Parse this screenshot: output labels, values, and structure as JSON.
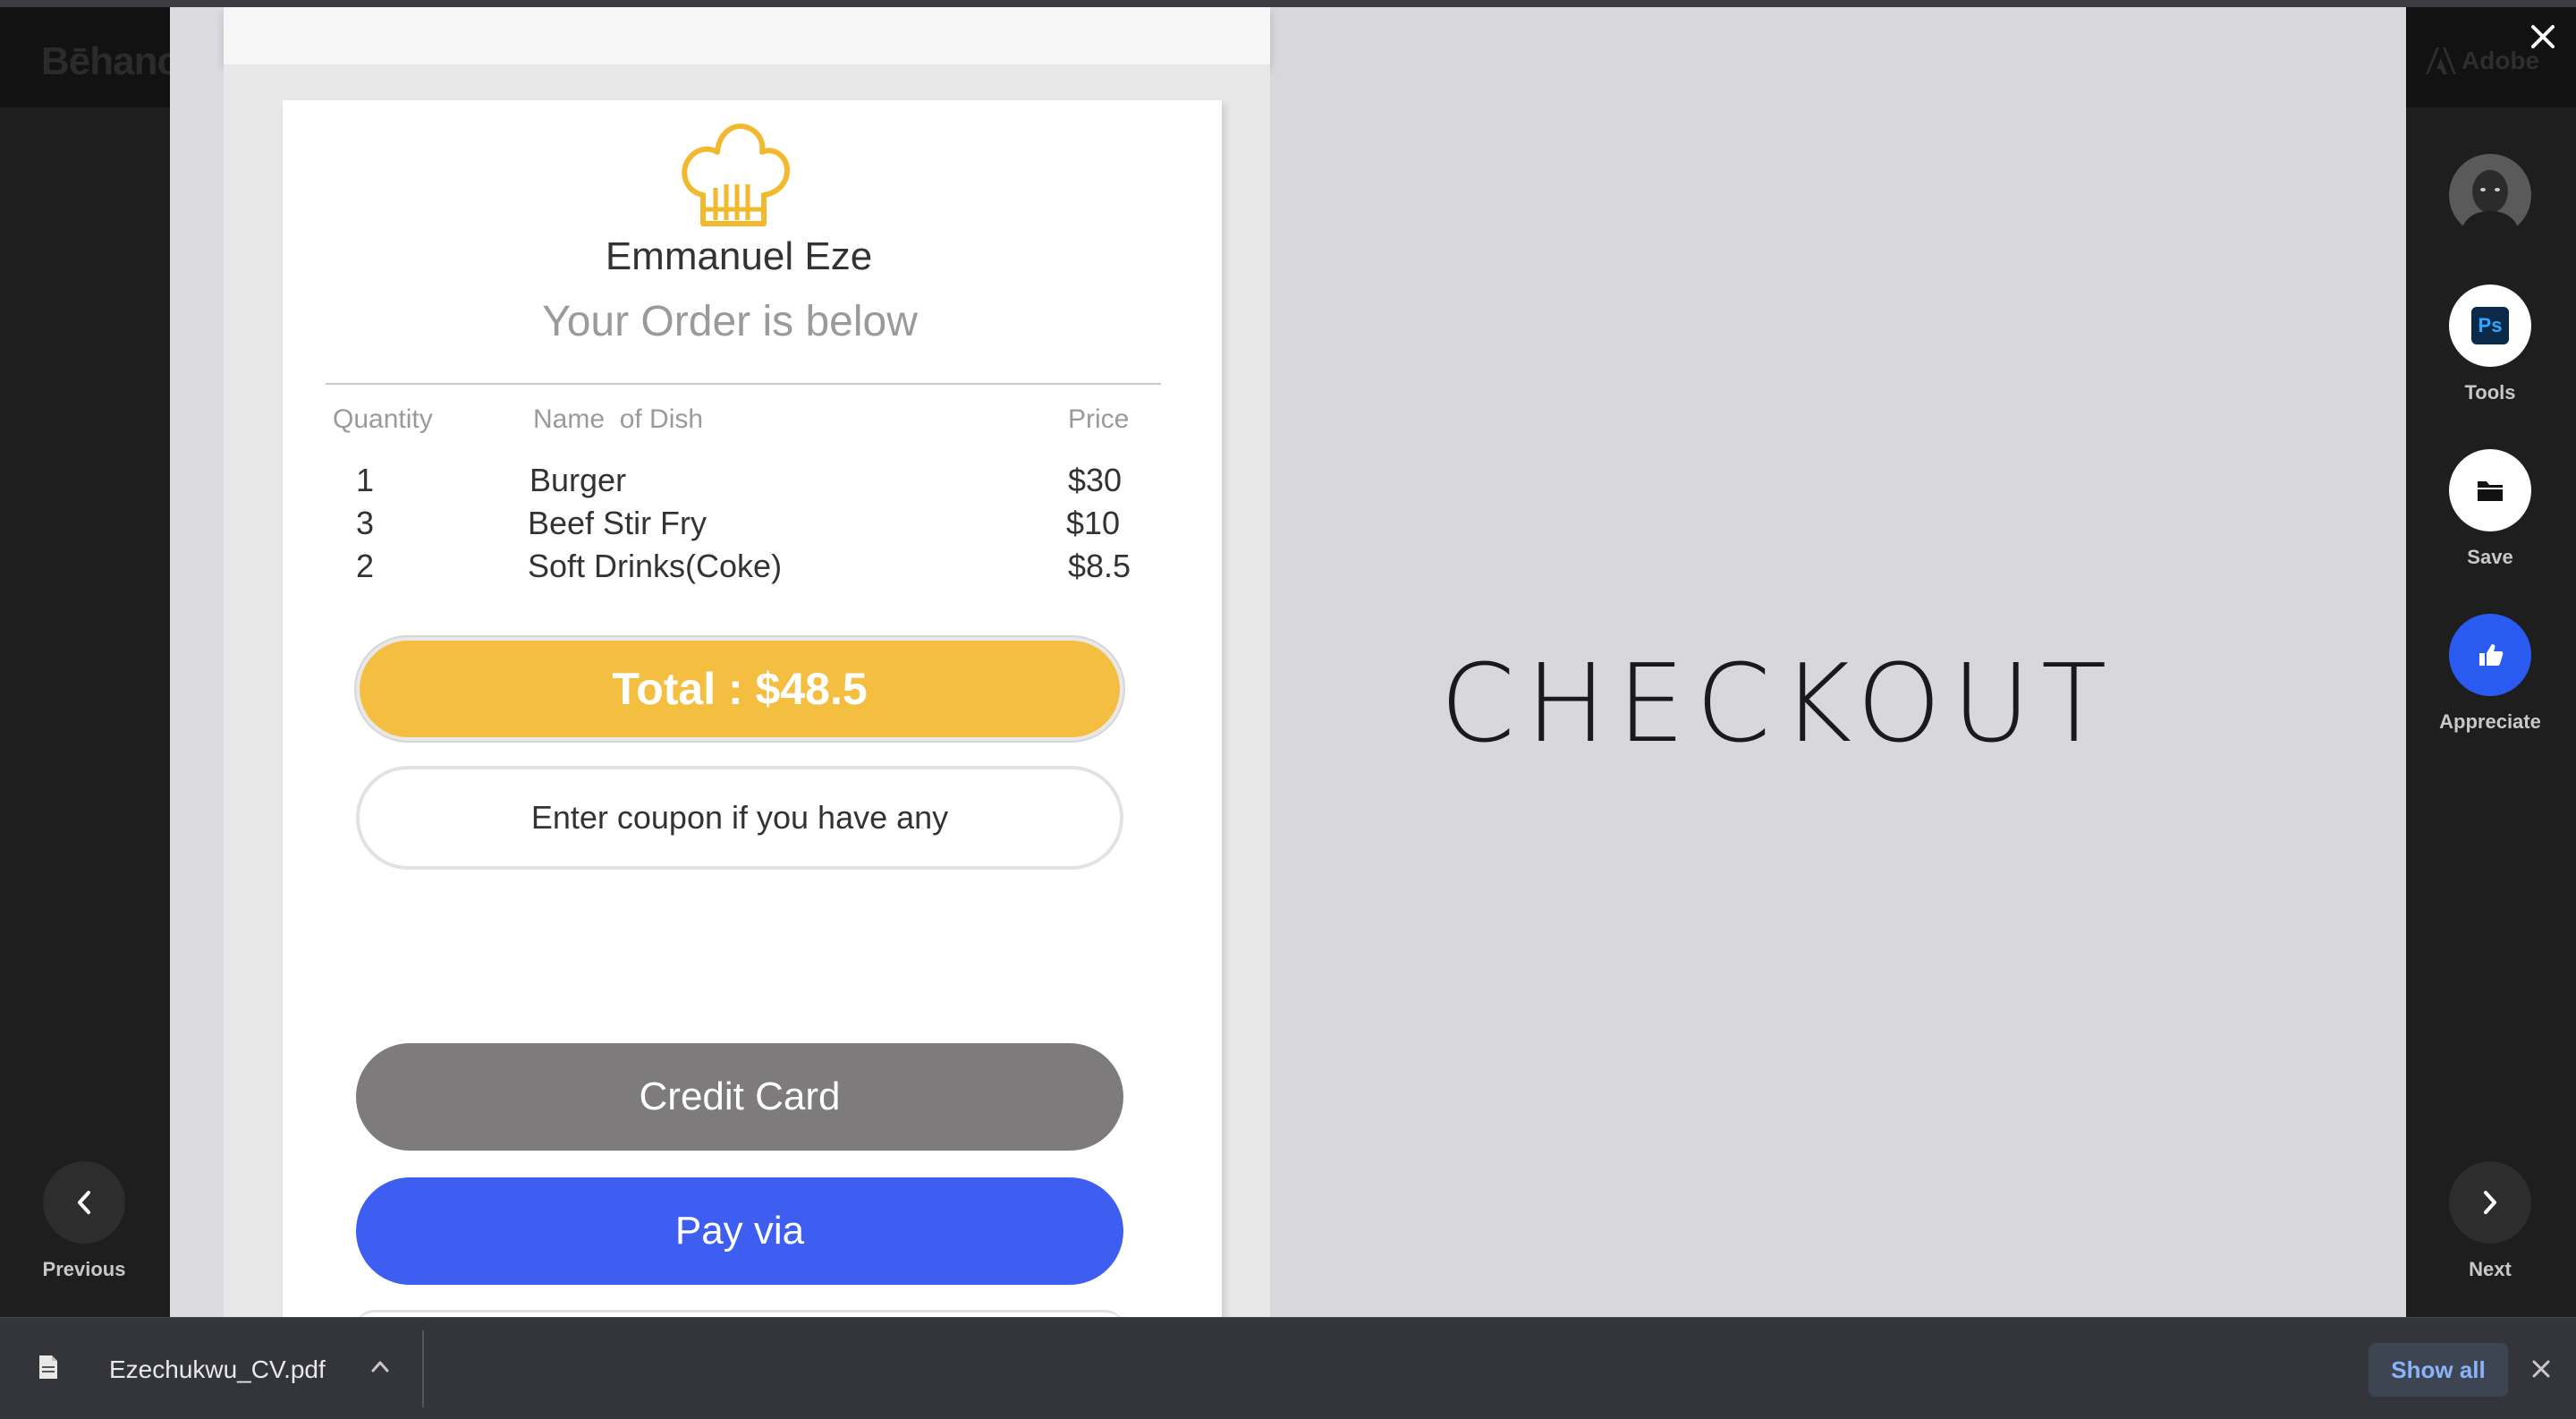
{
  "background": {
    "logo_text": "Bēhance",
    "adobe_text": "Adobe"
  },
  "project": {
    "owner_name": "Emmanuel Eze",
    "order_heading": "Your Order is below",
    "columns": {
      "quantity": "Quantity",
      "dish": "Name  of Dish",
      "price": "Price"
    },
    "order_rows": [
      {
        "quantity": "1",
        "dish": "Burger",
        "price": "$30"
      },
      {
        "quantity": "3",
        "dish": "Beef Stir Fry",
        "price": "$10"
      },
      {
        "quantity": "2",
        "dish": "Soft Drinks(Coke)",
        "price": "$8.5"
      }
    ],
    "total_label": "Total : $48.5",
    "coupon_placeholder": "Enter coupon if you have any",
    "credit_card_label": "Credit Card",
    "pay_via_label": "Pay via",
    "checkout_title": "CHECKOUT",
    "colors": {
      "total": "#f4bf41",
      "credit_card": "#7d7b7b",
      "pay_via": "#3d5ef0",
      "chef_hat": "#f1b92e"
    }
  },
  "rail": {
    "tools_label": "Tools",
    "tools_icon_text": "Ps",
    "save_label": "Save",
    "appreciate_label": "Appreciate",
    "appreciate_color": "#2a5bf0"
  },
  "navigation": {
    "previous_label": "Previous",
    "next_label": "Next"
  },
  "download_shelf": {
    "file_name": "Ezechukwu_CV.pdf",
    "show_all_label": "Show all"
  }
}
